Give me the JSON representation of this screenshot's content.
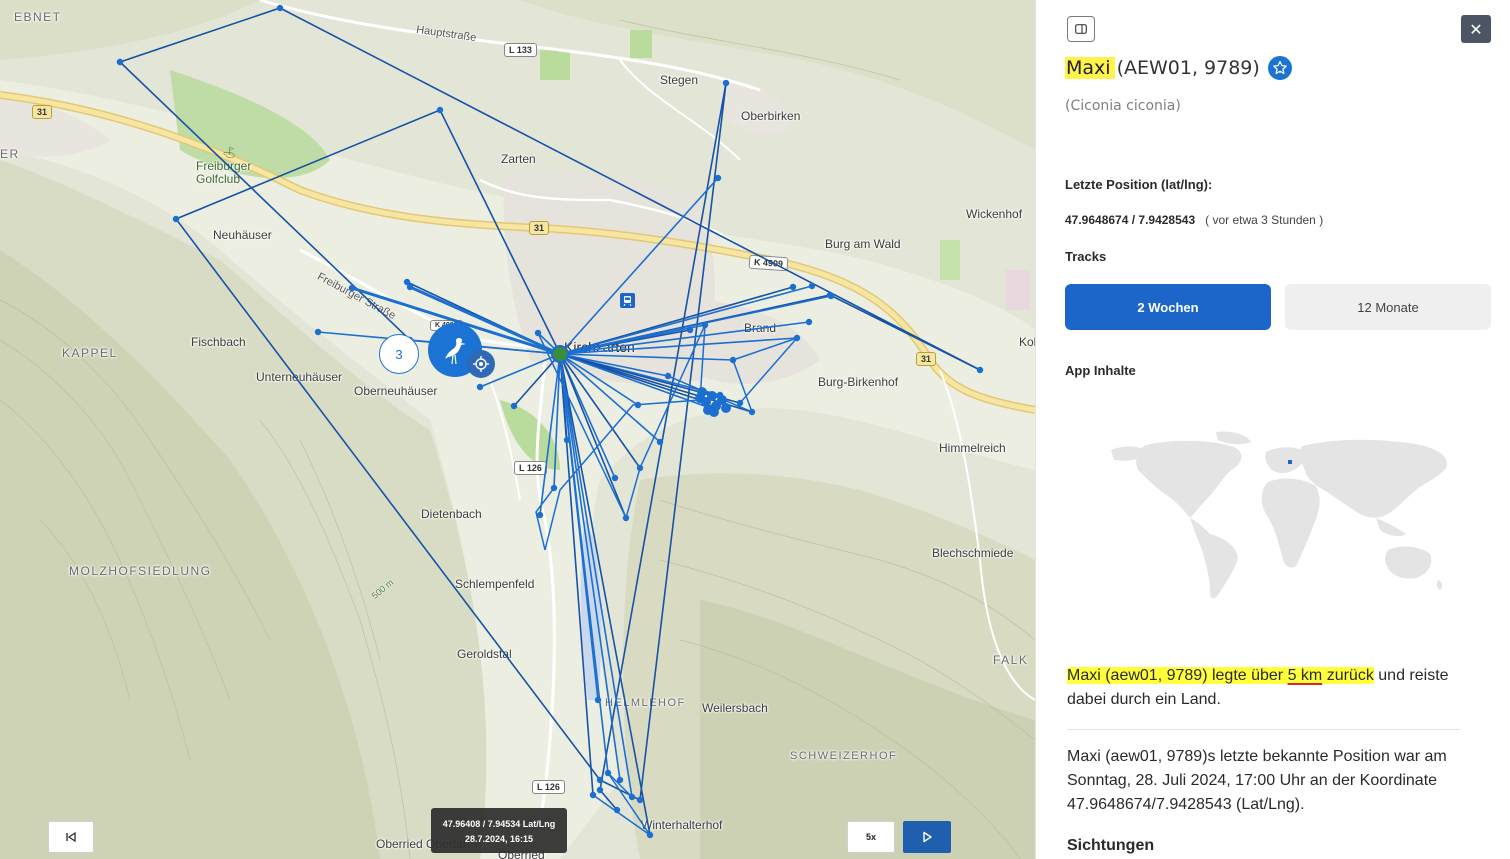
{
  "map": {
    "places": {
      "ebnet": "EBNET",
      "er": "ER",
      "hauptstrasse": "Hauptstraße",
      "stegen": "Stegen",
      "oberbirken": "Oberbirken",
      "zarten": "Zarten",
      "freiburger_golfclub": "Freiburger Golfclub",
      "neuhaeuser": "Neuhäuser",
      "wickenhof": "Wickenhof",
      "burg_am_wald": "Burg am Wald",
      "freiburger_strasse": "Freiburger Straße",
      "fischbach": "Fischbach",
      "kappel": "KAPPEL",
      "kirchzarten": "Kirchzarten",
      "brand": "Brand",
      "unterneuhaeuser": "Unterneuhäuser",
      "oberneuhaeuser": "Oberneuhäuser",
      "burg_birkenhof": "Burg-Birkenhof",
      "kol": "Kol",
      "himmelreich": "Himmelreich",
      "dietenbach": "Dietenbach",
      "blechschmiede": "Blechschmiede",
      "molzhofsiedlung": "MOLZHOFSIEDLUNG",
      "contour": "500 m",
      "schlempenfeld": "Schlempenfeld",
      "geroldstal": "Geroldstal",
      "falk": "FALK",
      "helmlehof": "HELMLEHOF",
      "weilersbach": "Weilersbach",
      "schweizerhof": "SCHWEIZERHOF",
      "winterhalterhof": "Winterhalterhof",
      "oberried_obertal": "Oberried Obertal",
      "oberried": "Oberried"
    },
    "roads": {
      "l133": "L 133",
      "b31_west": "31",
      "b31_center": "31",
      "k4909": "K 4909",
      "b31_east": "31",
      "l126_a": "L 126",
      "l126_b": "L 126",
      "k_small": "K 4909"
    },
    "cluster_count": "3",
    "tooltip": {
      "coords": "47.96408 / 7.94534 Lat/Lng",
      "datetime": "28.7.2024, 16:15"
    },
    "controls": {
      "speed_label": "5x"
    },
    "track_color": "#1b6fd1",
    "track_dark_color": "#1653a6"
  },
  "panel": {
    "name": "Maxi",
    "ids": "(AEW01, 9789)",
    "latin": "(Ciconia ciconia)",
    "last_position_label": "Letzte Position (lat/lng):",
    "last_position_value": "47.9648674 / 7.9428543",
    "last_position_ago": "( vor etwa 3 Stunden )",
    "tracks_label": "Tracks",
    "tracks": [
      {
        "label": "2 Wochen",
        "active": true
      },
      {
        "label": "12 Monate",
        "active": false
      }
    ],
    "app_contents_label": "App Inhalte",
    "summary_marked": "Maxi (aew01, 9789) legte über",
    "summary_underlined": "5 km",
    "summary_marked_end": "zurück",
    "summary_rest": "und reiste dabei durch ein Land.",
    "last_known": "Maxi (aew01, 9789)s letzte bekannte Position war am Sonntag, 28. Juli 2024, 17:00 Uhr an der Koordinate 47.9648674/7.9428543 (Lat/Lng).",
    "sightings_label": "Sichtungen",
    "accent_color": "#1b66c8",
    "highlight_color": "#fff24a"
  }
}
